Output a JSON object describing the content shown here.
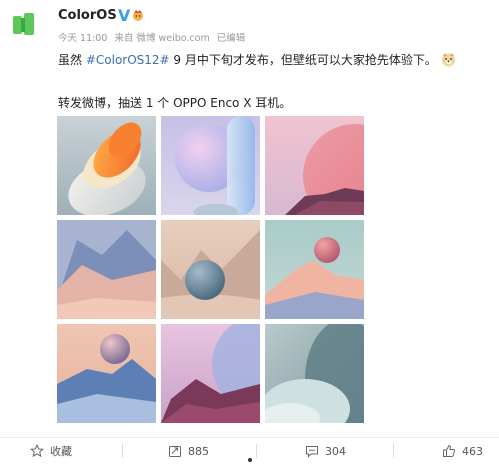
{
  "post": {
    "username": "ColorOS",
    "verified_badge": "V",
    "meta": {
      "date": "今天 11:00",
      "source": "来自 微博 weibo.com",
      "edited": "已编辑"
    },
    "text_line1_pre": "虽然 ",
    "hashtag": "#ColorOS12#",
    "text_line1_post": " 9 月中下旬才发布，但壁纸可以大家抢先体验下。",
    "text_line2": "转发微博，抽送 1 个 OPPO Enco X 耳机。"
  },
  "wallpapers": [
    "wallpaper-1",
    "wallpaper-2",
    "wallpaper-3",
    "wallpaper-4",
    "wallpaper-5",
    "wallpaper-6",
    "wallpaper-7",
    "wallpaper-8",
    "wallpaper-9"
  ],
  "footer": {
    "favorite_label": "收藏",
    "repost_count": "885",
    "comment_count": "304",
    "like_count": "463"
  },
  "icons": {
    "favorite": "star-icon",
    "repost": "repost-icon",
    "comment": "comment-icon",
    "like": "thumbs-up-icon"
  },
  "colors": {
    "brand_green": "#5cc85a",
    "hashtag_blue": "#3a6fb0",
    "verified_blue": "#3aa0e8"
  }
}
